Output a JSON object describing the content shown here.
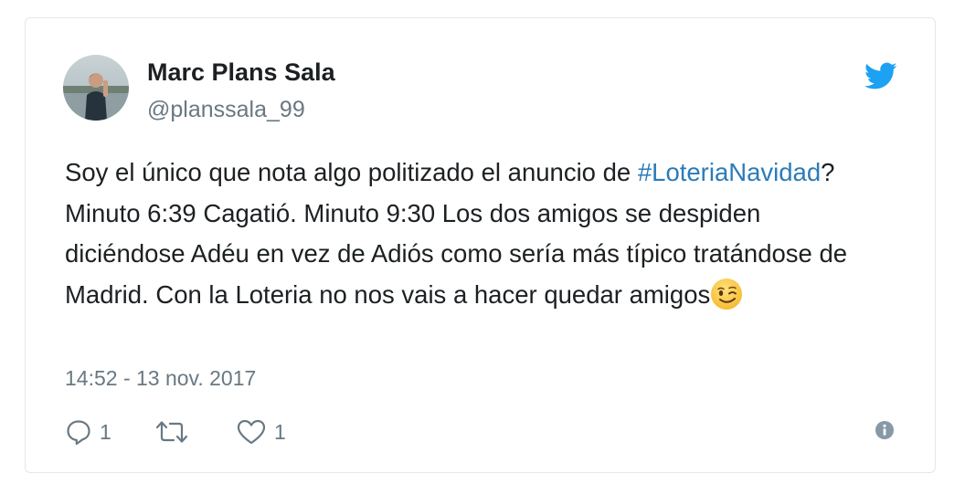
{
  "tweet": {
    "author": {
      "name": "Marc Plans Sala",
      "handle": "@planssala_99"
    },
    "text": {
      "before_hashtag": "Soy el único que nota algo politizado el anuncio de ",
      "hashtag": "#LoteriaNavidad",
      "after_hashtag": "? Minuto 6:39 Cagatió. Minuto 9:30 Los dos amigos se despiden diciéndose Adéu en vez de Adiós como sería más típico tratándose de Madrid. Con la Loteria no nos vais a hacer quedar amigos",
      "emoji": "winking-face"
    },
    "timestamp": "14:52 - 13 nov. 2017",
    "actions": {
      "reply_count": "1",
      "retweet_count": "",
      "like_count": "1"
    }
  },
  "colors": {
    "brand_blue": "#1da1f2",
    "link_blue": "#2b7bb9",
    "text_primary": "#1c2022",
    "text_secondary": "#697882",
    "border": "#e1e8ed"
  },
  "icons": [
    "avatar",
    "twitter-bird-icon",
    "winking-face-emoji",
    "reply-icon",
    "retweet-icon",
    "heart-icon",
    "info-icon"
  ]
}
